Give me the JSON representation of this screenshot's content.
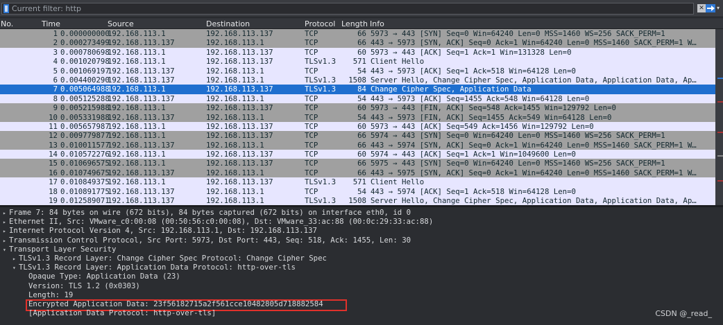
{
  "filter": {
    "placeholder": "Current filter: http"
  },
  "columns": {
    "no": "No.",
    "time": "Time",
    "source": "Source",
    "destination": "Destination",
    "protocol": "Protocol",
    "length": "Length",
    "info": "Info"
  },
  "packets": [
    {
      "no": "1",
      "time": "0.000000000",
      "src": "192.168.113.1",
      "dst": "192.168.113.137",
      "proto": "TCP",
      "len": "66",
      "info": "5973 → 443 [SYN] Seq=0 Win=64240 Len=0 MSS=1460 WS=256 SACK_PERM=1",
      "style": "gray"
    },
    {
      "no": "2",
      "time": "0.000273499",
      "src": "192.168.113.137",
      "dst": "192.168.113.1",
      "proto": "TCP",
      "len": "66",
      "info": "443 → 5973 [SYN, ACK] Seq=0 Ack=1 Win=64240 Len=0 MSS=1460 SACK_PERM=1 W…",
      "style": "gray"
    },
    {
      "no": "3",
      "time": "0.000780698",
      "src": "192.168.113.1",
      "dst": "192.168.113.137",
      "proto": "TCP",
      "len": "60",
      "info": "5973 → 443 [ACK] Seq=1 Ack=1 Win=131328 Len=0",
      "style": "tcp"
    },
    {
      "no": "4",
      "time": "0.001020798",
      "src": "192.168.113.1",
      "dst": "192.168.113.137",
      "proto": "TLSv1.3",
      "len": "571",
      "info": "Client Hello",
      "style": "tls"
    },
    {
      "no": "5",
      "time": "0.001069197",
      "src": "192.168.113.137",
      "dst": "192.168.113.1",
      "proto": "TCP",
      "len": "54",
      "info": "443 → 5973 [ACK] Seq=1 Ack=518 Win=64128 Len=0",
      "style": "tcp"
    },
    {
      "no": "6",
      "time": "0.004400290",
      "src": "192.168.113.137",
      "dst": "192.168.113.1",
      "proto": "TLSv1.3",
      "len": "1508",
      "info": "Server Hello, Change Cipher Spec, Application Data, Application Data, Ap…",
      "style": "tls"
    },
    {
      "no": "7",
      "time": "0.005064988",
      "src": "192.168.113.1",
      "dst": "192.168.113.137",
      "proto": "TLSv1.3",
      "len": "84",
      "info": "Change Cipher Spec, Application Data",
      "style": "selected"
    },
    {
      "no": "8",
      "time": "0.005125288",
      "src": "192.168.113.137",
      "dst": "192.168.113.1",
      "proto": "TCP",
      "len": "54",
      "info": "443 → 5973 [ACK] Seq=1455 Ack=548 Win=64128 Len=0",
      "style": "tcp"
    },
    {
      "no": "9",
      "time": "0.005215988",
      "src": "192.168.113.1",
      "dst": "192.168.113.137",
      "proto": "TCP",
      "len": "60",
      "info": "5973 → 443 [FIN, ACK] Seq=548 Ack=1455 Win=129792 Len=0",
      "style": "gray"
    },
    {
      "no": "10",
      "time": "0.005331988",
      "src": "192.168.113.137",
      "dst": "192.168.113.1",
      "proto": "TCP",
      "len": "54",
      "info": "443 → 5973 [FIN, ACK] Seq=1455 Ack=549 Win=64128 Len=0",
      "style": "gray"
    },
    {
      "no": "11",
      "time": "0.005657987",
      "src": "192.168.113.1",
      "dst": "192.168.113.137",
      "proto": "TCP",
      "len": "60",
      "info": "5973 → 443 [ACK] Seq=549 Ack=1456 Win=129792 Len=0",
      "style": "tcp"
    },
    {
      "no": "12",
      "time": "0.009779877",
      "src": "192.168.113.1",
      "dst": "192.168.113.137",
      "proto": "TCP",
      "len": "66",
      "info": "5974 → 443 [SYN] Seq=0 Win=64240 Len=0 MSS=1460 WS=256 SACK_PERM=1",
      "style": "gray"
    },
    {
      "no": "13",
      "time": "0.010011577",
      "src": "192.168.113.137",
      "dst": "192.168.113.1",
      "proto": "TCP",
      "len": "66",
      "info": "443 → 5974 [SYN, ACK] Seq=0 Ack=1 Win=64240 Len=0 MSS=1460 SACK_PERM=1 W…",
      "style": "gray"
    },
    {
      "no": "14",
      "time": "0.010572276",
      "src": "192.168.113.1",
      "dst": "192.168.113.137",
      "proto": "TCP",
      "len": "60",
      "info": "5974 → 443 [ACK] Seq=1 Ack=1 Win=1049600 Len=0",
      "style": "tcp"
    },
    {
      "no": "15",
      "time": "0.010696575",
      "src": "192.168.113.1",
      "dst": "192.168.113.137",
      "proto": "TCP",
      "len": "66",
      "info": "5975 → 443 [SYN] Seq=0 Win=64240 Len=0 MSS=1460 WS=256 SACK_PERM=1",
      "style": "gray"
    },
    {
      "no": "16",
      "time": "0.010749675",
      "src": "192.168.113.137",
      "dst": "192.168.113.1",
      "proto": "TCP",
      "len": "66",
      "info": "443 → 5975 [SYN, ACK] Seq=0 Ack=1 Win=64240 Len=0 MSS=1460 SACK_PERM=1 W…",
      "style": "gray"
    },
    {
      "no": "17",
      "time": "0.010849375",
      "src": "192.168.113.1",
      "dst": "192.168.113.137",
      "proto": "TLSv1.3",
      "len": "571",
      "info": "Client Hello",
      "style": "tls"
    },
    {
      "no": "18",
      "time": "0.010891775",
      "src": "192.168.113.137",
      "dst": "192.168.113.1",
      "proto": "TCP",
      "len": "54",
      "info": "443 → 5974 [ACK] Seq=1 Ack=518 Win=64128 Len=0",
      "style": "tcp"
    },
    {
      "no": "19",
      "time": "0.012589071",
      "src": "192.168.113.137",
      "dst": "192.168.113.1",
      "proto": "TLSv1.3",
      "len": "1508",
      "info": "Server Hello, Change Cipher Spec, Application Data, Application Data, Ap…",
      "style": "tls"
    }
  ],
  "details": [
    {
      "indent": 0,
      "arrow": "collapsed",
      "text": "Frame 7: 84 bytes on wire (672 bits), 84 bytes captured (672 bits) on interface eth0, id 0"
    },
    {
      "indent": 0,
      "arrow": "collapsed",
      "text": "Ethernet II, Src: VMware_c0:00:08 (00:50:56:c0:00:08), Dst: VMware_33:ac:88 (00:0c:29:33:ac:88)"
    },
    {
      "indent": 0,
      "arrow": "collapsed",
      "text": "Internet Protocol Version 4, Src: 192.168.113.1, Dst: 192.168.113.137"
    },
    {
      "indent": 0,
      "arrow": "collapsed",
      "text": "Transmission Control Protocol, Src Port: 5973, Dst Port: 443, Seq: 518, Ack: 1455, Len: 30"
    },
    {
      "indent": 0,
      "arrow": "expanded",
      "text": "Transport Layer Security"
    },
    {
      "indent": 1,
      "arrow": "collapsed",
      "text": "TLSv1.3 Record Layer: Change Cipher Spec Protocol: Change Cipher Spec"
    },
    {
      "indent": 1,
      "arrow": "expanded",
      "text": "TLSv1.3 Record Layer: Application Data Protocol: http-over-tls"
    },
    {
      "indent": 2,
      "arrow": "none",
      "text": "Opaque Type: Application Data (23)"
    },
    {
      "indent": 2,
      "arrow": "none",
      "text": "Version: TLS 1.2 (0x0303)"
    },
    {
      "indent": 2,
      "arrow": "none",
      "text": "Length: 19"
    },
    {
      "indent": 2,
      "arrow": "none",
      "text": "Encrypted Application Data: 23f56182715a2f561cce10482805d718882584"
    },
    {
      "indent": 2,
      "arrow": "none",
      "text": "[Application Data Protocol: http-over-tls]"
    }
  ],
  "watermark": "CSDN @_read_",
  "colors": {
    "selected": "#1f6fcf",
    "tls_row": "#e7e6ff",
    "gray_row": "#a0a0a0",
    "highlight_box": "#e0312b"
  },
  "icons": {
    "bookmark": "bookmark-icon",
    "clear": "clear-icon",
    "apply": "arrow-right-icon",
    "dropdown": "chevron-down-icon"
  }
}
